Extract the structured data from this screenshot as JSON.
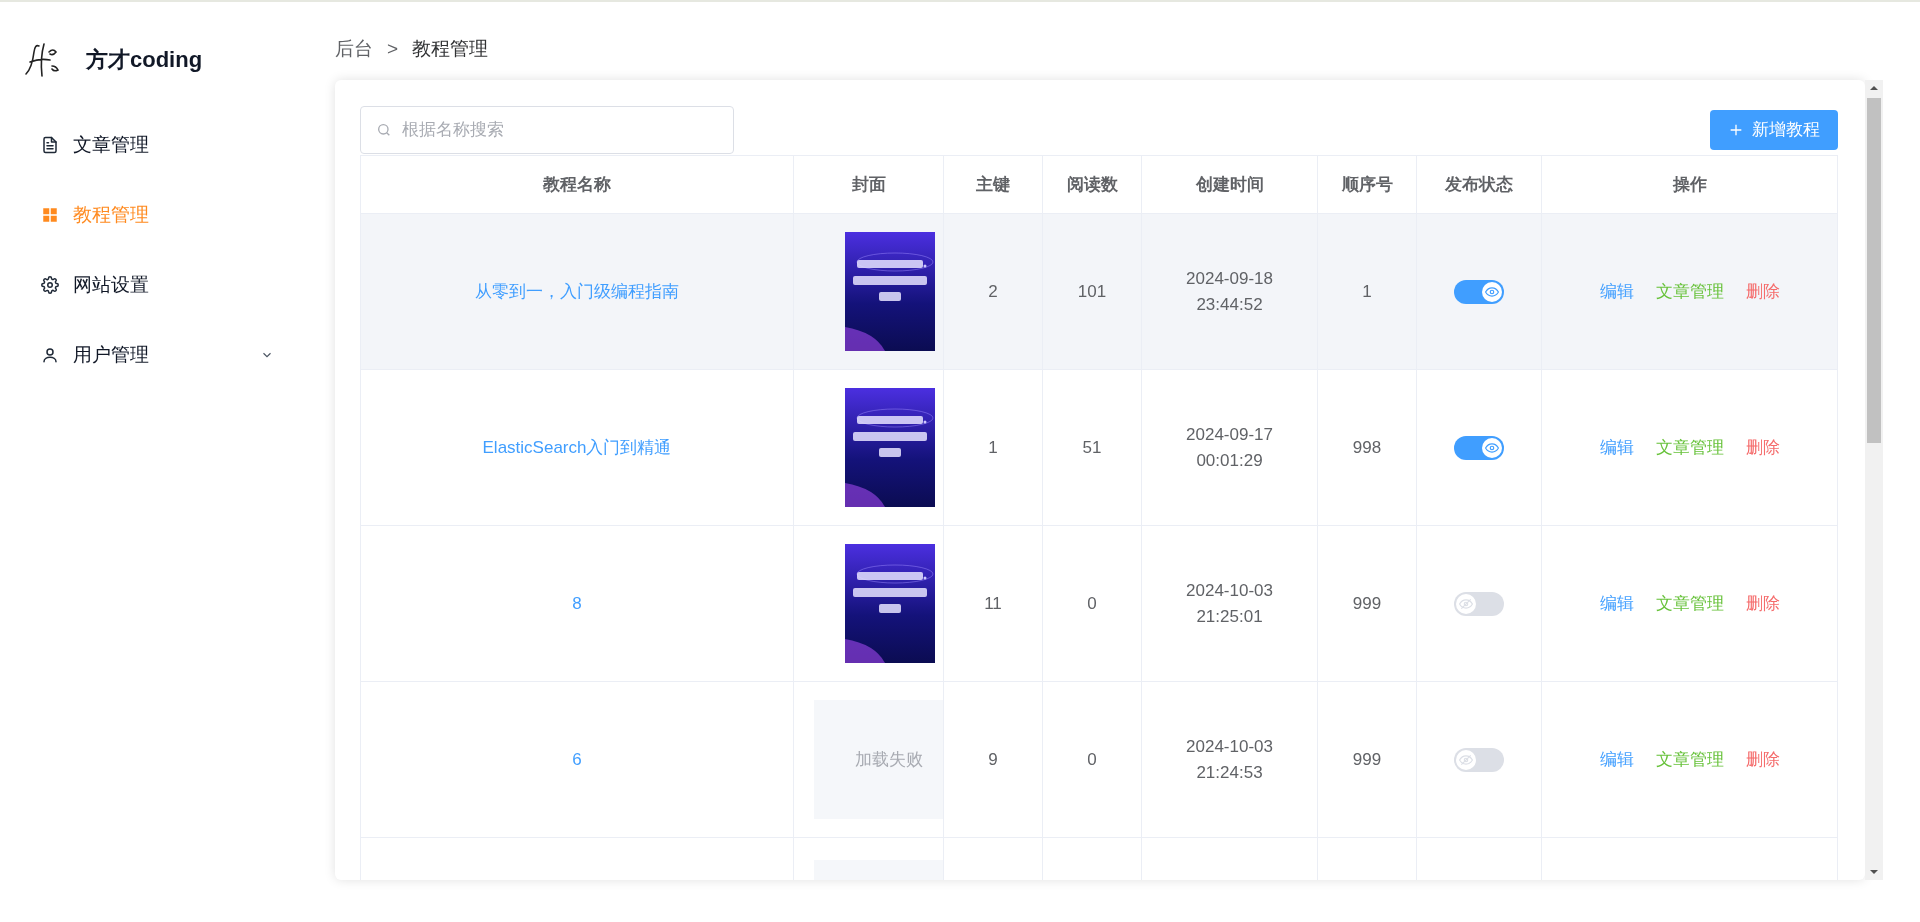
{
  "brand": {
    "name": "方才coding"
  },
  "sidebar": {
    "items": [
      {
        "label": "文章管理",
        "kind": "document",
        "selected": false,
        "expandable": false
      },
      {
        "label": "教程管理",
        "kind": "grid",
        "selected": true,
        "expandable": false
      },
      {
        "label": "网站设置",
        "kind": "gear",
        "selected": false,
        "expandable": false
      },
      {
        "label": "用户管理",
        "kind": "user",
        "selected": false,
        "expandable": true
      }
    ]
  },
  "breadcrumb": [
    "后台",
    "教程管理"
  ],
  "breadcrumb_separator": ">",
  "search": {
    "placeholder": "根据名称搜索"
  },
  "add_button": {
    "label": "新增教程"
  },
  "table": {
    "columns": [
      "教程名称",
      "封面",
      "主键",
      "阅读数",
      "创建时间",
      "顺序号",
      "发布状态",
      "操作"
    ],
    "rows": [
      {
        "name": "从零到一，入门级编程指南",
        "cover": {
          "kind": "picture"
        },
        "id": "2",
        "reads": "101",
        "date": "2024-09-18",
        "time": "23:44:52",
        "order": "1",
        "published": true,
        "highlighted": true,
        "actions": [
          "编辑",
          "文章管理",
          "删除"
        ]
      },
      {
        "name": "ElasticSearch入门到精通",
        "cover": {
          "kind": "picture"
        },
        "id": "1",
        "reads": "51",
        "date": "2024-09-17",
        "time": "00:01:29",
        "order": "998",
        "published": true,
        "highlighted": false,
        "actions": [
          "编辑",
          "文章管理",
          "删除"
        ]
      },
      {
        "name": "8",
        "cover": {
          "kind": "picture"
        },
        "id": "11",
        "reads": "0",
        "date": "2024-10-03",
        "time": "21:25:01",
        "order": "999",
        "published": false,
        "highlighted": false,
        "actions": [
          "编辑",
          "文章管理",
          "删除"
        ]
      },
      {
        "name": "6",
        "cover": {
          "kind": "failed",
          "text": "加载失败"
        },
        "id": "9",
        "reads": "0",
        "date": "2024-10-03",
        "time": "21:24:53",
        "order": "999",
        "published": false,
        "highlighted": false,
        "actions": [
          "编辑",
          "文章管理",
          "删除"
        ]
      },
      {
        "cover": {
          "kind": "empty"
        },
        "highlighted": false
      }
    ]
  }
}
